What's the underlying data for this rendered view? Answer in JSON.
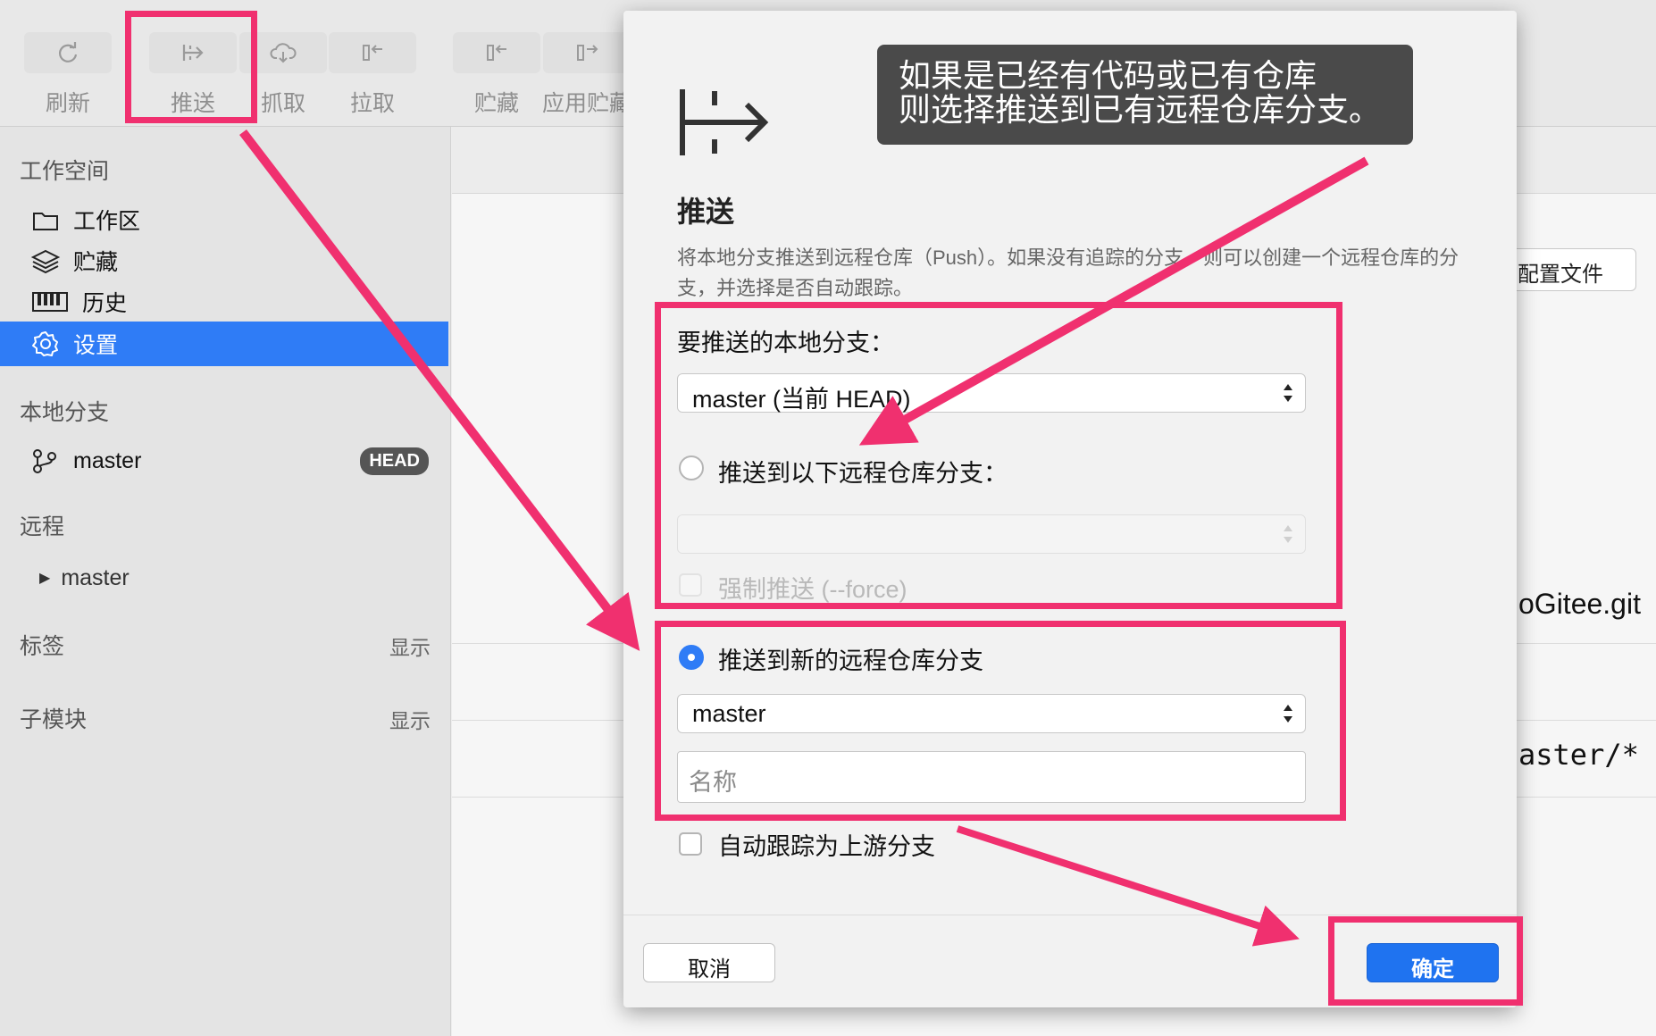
{
  "toolbar": {
    "buttons": [
      {
        "label": "刷新",
        "icon": "refresh-icon"
      },
      {
        "label": "推送",
        "icon": "push-icon"
      },
      {
        "label": "抓取",
        "icon": "cloud-download-icon"
      },
      {
        "label": "拉取",
        "icon": "pull-icon"
      },
      {
        "label": "贮藏",
        "icon": "stash-icon"
      },
      {
        "label": "应用贮藏",
        "icon": "apply-stash-icon"
      }
    ]
  },
  "sidebar": {
    "workspace_title": "工作空间",
    "workspace_items": [
      {
        "label": "工作区",
        "icon": "folder-icon"
      },
      {
        "label": "贮藏",
        "icon": "layers-icon"
      },
      {
        "label": "历史",
        "icon": "history-icon"
      },
      {
        "label": "设置",
        "icon": "gear-icon"
      }
    ],
    "local_branches_title": "本地分支",
    "local_branch": {
      "name": "master",
      "badge": "HEAD",
      "icon": "branch-icon"
    },
    "remote_title": "远程",
    "remote_item": "master",
    "tags_title": "标签",
    "tags_show": "显示",
    "submodules_title": "子模块",
    "submodules_show": "显示"
  },
  "background": {
    "config_button": "配置文件",
    "repo_suffix": "oGitee.git",
    "refspec_suffix": "aster/*"
  },
  "dialog": {
    "title": "推送",
    "description": "将本地分支推送到远程仓库（Push）。如果没有追踪的分支，则可以创建一个远程仓库的分支，并选择是否自动跟踪。",
    "local_branch_label": "要推送的本地分支：",
    "local_branch_value": "master (当前 HEAD)",
    "existing_remote_option": "推送到以下远程仓库分支：",
    "existing_remote_value": "",
    "force_option": "强制推送 (--force)",
    "new_remote_option": "推送到新的远程仓库分支",
    "new_remote_value": "master",
    "name_placeholder": "名称",
    "auto_track_option": "自动跟踪为上游分支",
    "cancel_label": "取消",
    "ok_label": "确定"
  },
  "callout": {
    "line1": "如果是已经有代码或已有仓库",
    "line2": "则选择推送到已有远程仓库分支。"
  },
  "colors": {
    "accent": "#2f7cf6",
    "annotation": "#f0306f",
    "callout_bg": "#4a4a4a"
  }
}
